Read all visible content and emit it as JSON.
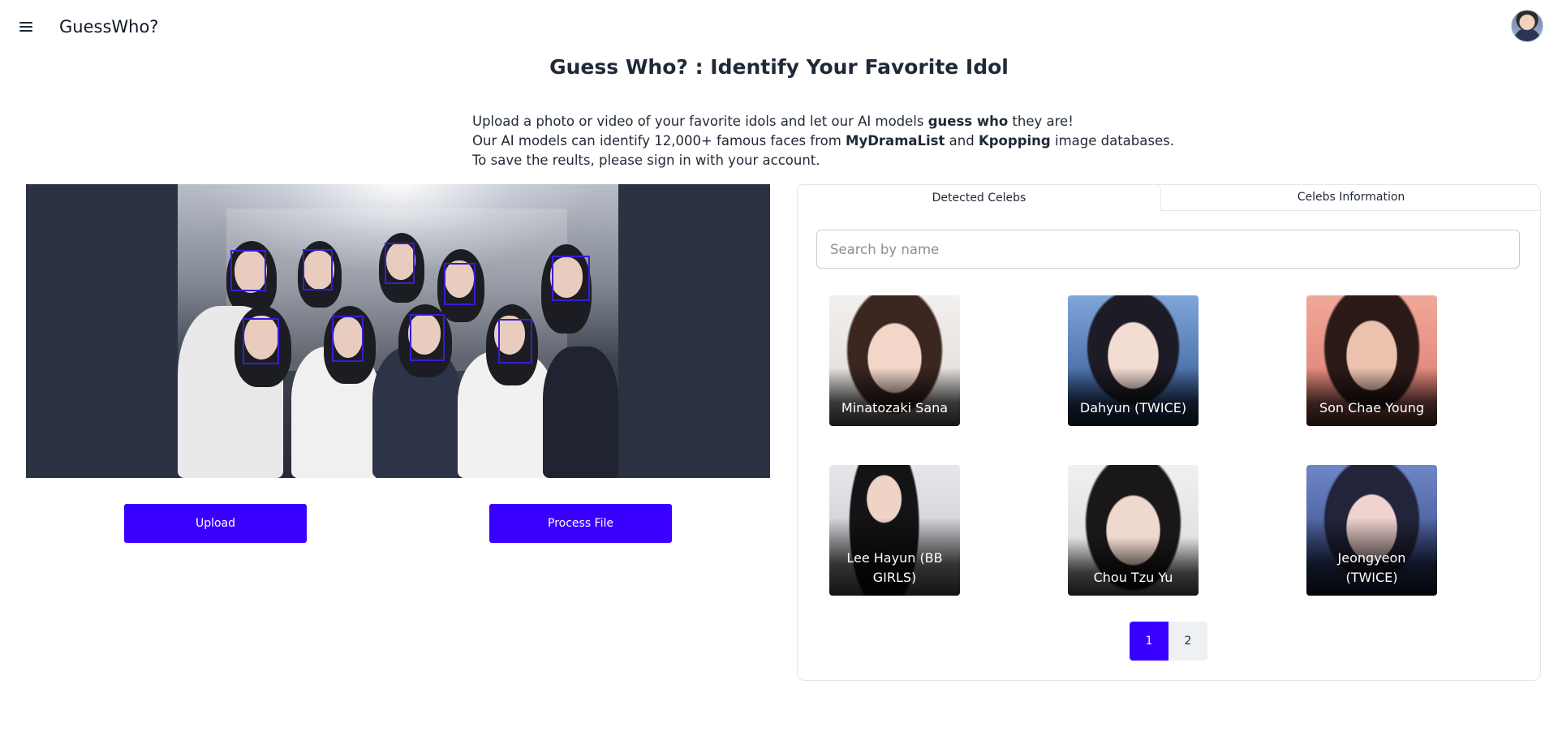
{
  "app": {
    "brand": "GuessWho?"
  },
  "page": {
    "title": "Guess Who? : Identify Your Favorite Idol"
  },
  "intro": {
    "line1_a": "Upload a photo or video of your favorite idols and let our AI models ",
    "line1_b": "guess who",
    "line1_c": " they are!",
    "line2_a": "Our AI models can identify 12,000+ famous faces from ",
    "line2_b": "MyDramaList",
    "line2_c": " and ",
    "line2_d": "Kpopping",
    "line2_e": " image databases.",
    "line3": "To save the reults, please sign in with your account."
  },
  "actions": {
    "upload": "Upload",
    "process": "Process File"
  },
  "tabs": [
    {
      "label": "Detected Celebs"
    },
    {
      "label": "Celebs Information"
    }
  ],
  "search": {
    "placeholder": "Search by name",
    "value": ""
  },
  "celebs": [
    {
      "name": "Minatozaki Sana"
    },
    {
      "name": "Dahyun (TWICE)"
    },
    {
      "name": "Son Chae Young"
    },
    {
      "name": "Lee Hayun (BB GIRLS)"
    },
    {
      "name": "Chou Tzu Yu"
    },
    {
      "name": "Jeongyeon (TWICE)"
    }
  ],
  "pagination": {
    "pages": [
      "1",
      "2"
    ],
    "current": "1"
  },
  "colors": {
    "accent": "#3a00ff",
    "media_bg": "#2b3241",
    "face_box": "#3b1bd9"
  }
}
